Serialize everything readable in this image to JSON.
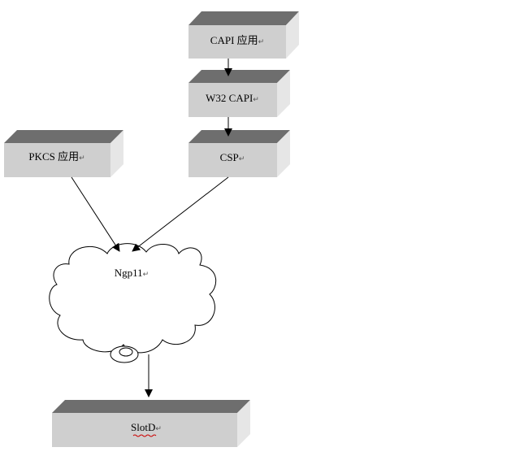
{
  "diagram": {
    "colors": {
      "box_top": "#6e6e6e",
      "box_front": "#cfcfcf",
      "box_side": "#e6e6e6",
      "line": "#000000",
      "underline": "#cc0000"
    },
    "nodes": {
      "capi_app": {
        "label": "CAPI 应用",
        "shape": "3d-box"
      },
      "w32_capi": {
        "label": "W32 CAPI",
        "shape": "3d-box"
      },
      "csp": {
        "label": "CSP",
        "shape": "3d-box"
      },
      "pkcs_app": {
        "label": "PKCS 应用",
        "shape": "3d-box"
      },
      "ngp11": {
        "label": "Ngp11",
        "shape": "cloud"
      },
      "slotd": {
        "label": "SlotD",
        "shape": "3d-box"
      }
    },
    "paragraph_mark": "↵",
    "edges": [
      {
        "from": "capi_app",
        "to": "w32_capi"
      },
      {
        "from": "w32_capi",
        "to": "csp"
      },
      {
        "from": "pkcs_app",
        "to": "ngp11"
      },
      {
        "from": "csp",
        "to": "ngp11"
      },
      {
        "from": "ngp11",
        "to": "slotd"
      }
    ]
  }
}
